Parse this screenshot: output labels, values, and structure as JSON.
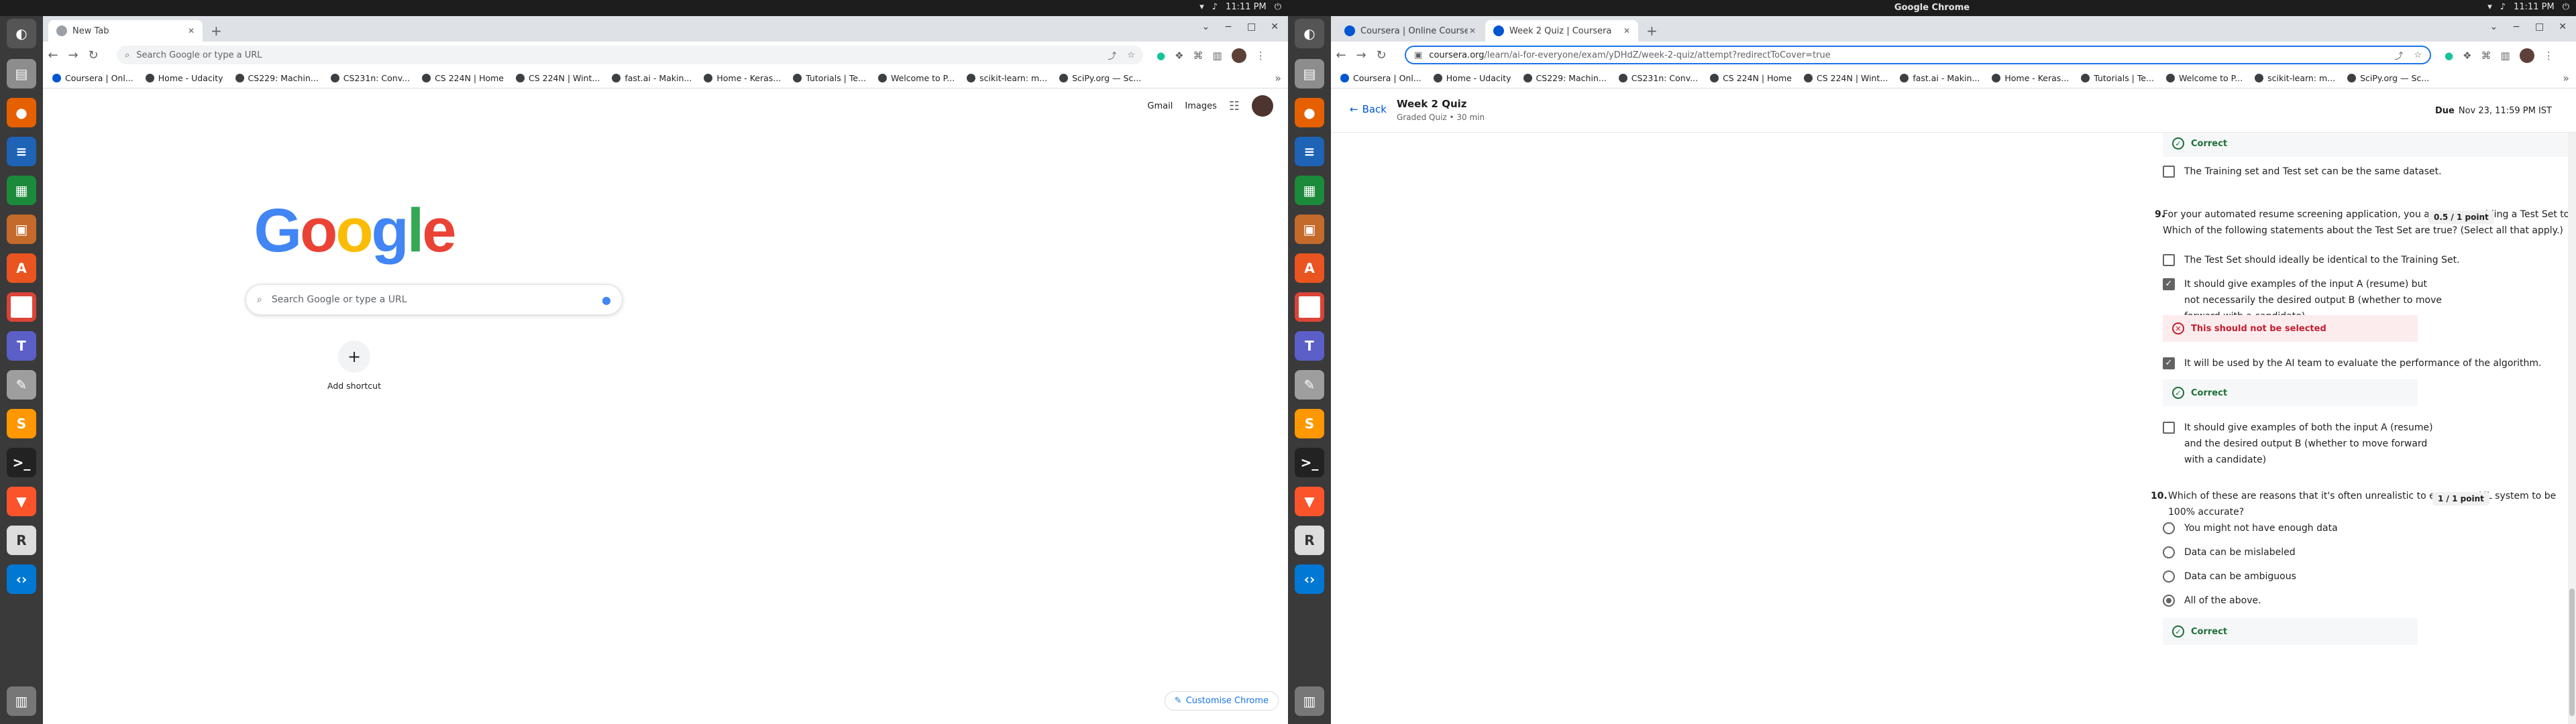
{
  "system": {
    "time": "11:11 PM",
    "active_app": "Google Chrome"
  },
  "left_browser": {
    "tab": {
      "label": "New Tab"
    },
    "omnibox_placeholder": "Search Google or type a URL",
    "google": {
      "gmail": "Gmail",
      "images": "Images",
      "search_placeholder": "Search Google or type a URL",
      "add_shortcut": "Add shortcut",
      "customise": "Customise Chrome"
    }
  },
  "bookmarks": [
    "Coursera | Onl...",
    "Home - Udacity",
    "CS229: Machin...",
    "CS231n: Conv...",
    "CS 224N | Home",
    "CS 224N | Wint...",
    "fast.ai - Makin...",
    "Home - Keras...",
    "Tutorials | Te...",
    "Welcome to P...",
    "scikit-learn: m...",
    "SciPy.org — Sc..."
  ],
  "right_browser": {
    "tabs": [
      {
        "label": "Coursera | Online Course"
      },
      {
        "label": "Week 2 Quiz | Coursera"
      }
    ],
    "url_domain": "coursera.org",
    "url_path": "/learn/ai-for-everyone/exam/yDHdZ/week-2-quiz/attempt?redirectToCover=true",
    "quiz": {
      "back": "Back",
      "title": "Week 2 Quiz",
      "subtitle": "Graded Quiz • 30 min",
      "due_label": "Due",
      "due_date": "Nov 23, 11:59 PM IST"
    },
    "prev": {
      "feedback": "Correct",
      "option": "The Training set and Test set can be the same dataset."
    },
    "q9": {
      "number": "9.",
      "text": "For your automated resume screening application, you are now providing a Test Set to the AI team. Which of the following statements about the Test Set are true? (Select all that apply.)",
      "points": "0.5 / 1 point",
      "options": [
        "The Test Set should ideally be identical to the Training Set.",
        "It should give examples of the input A (resume) but not necessarily the desired output B (whether to move forward with a candidate).",
        "It will be used by the AI team to evaluate the performance of the algorithm.",
        "It should give examples of both the input A (resume) and the desired output B (whether to move forward with a candidate)"
      ],
      "feedback_bad": "This should not be selected",
      "feedback_ok": "Correct"
    },
    "q10": {
      "number": "10.",
      "text": "Which of these are reasons that it's often unrealistic to expect an ML system to be 100% accurate?",
      "points": "1 / 1 point",
      "options": [
        "You might not have enough data",
        "Data can be mislabeled",
        "Data can be ambiguous",
        "All of the above."
      ],
      "feedback_ok": "Correct"
    }
  },
  "colors": {
    "accent": "#0056d2",
    "correct": "#1c6e38",
    "incorrect": "#c21f2f"
  }
}
